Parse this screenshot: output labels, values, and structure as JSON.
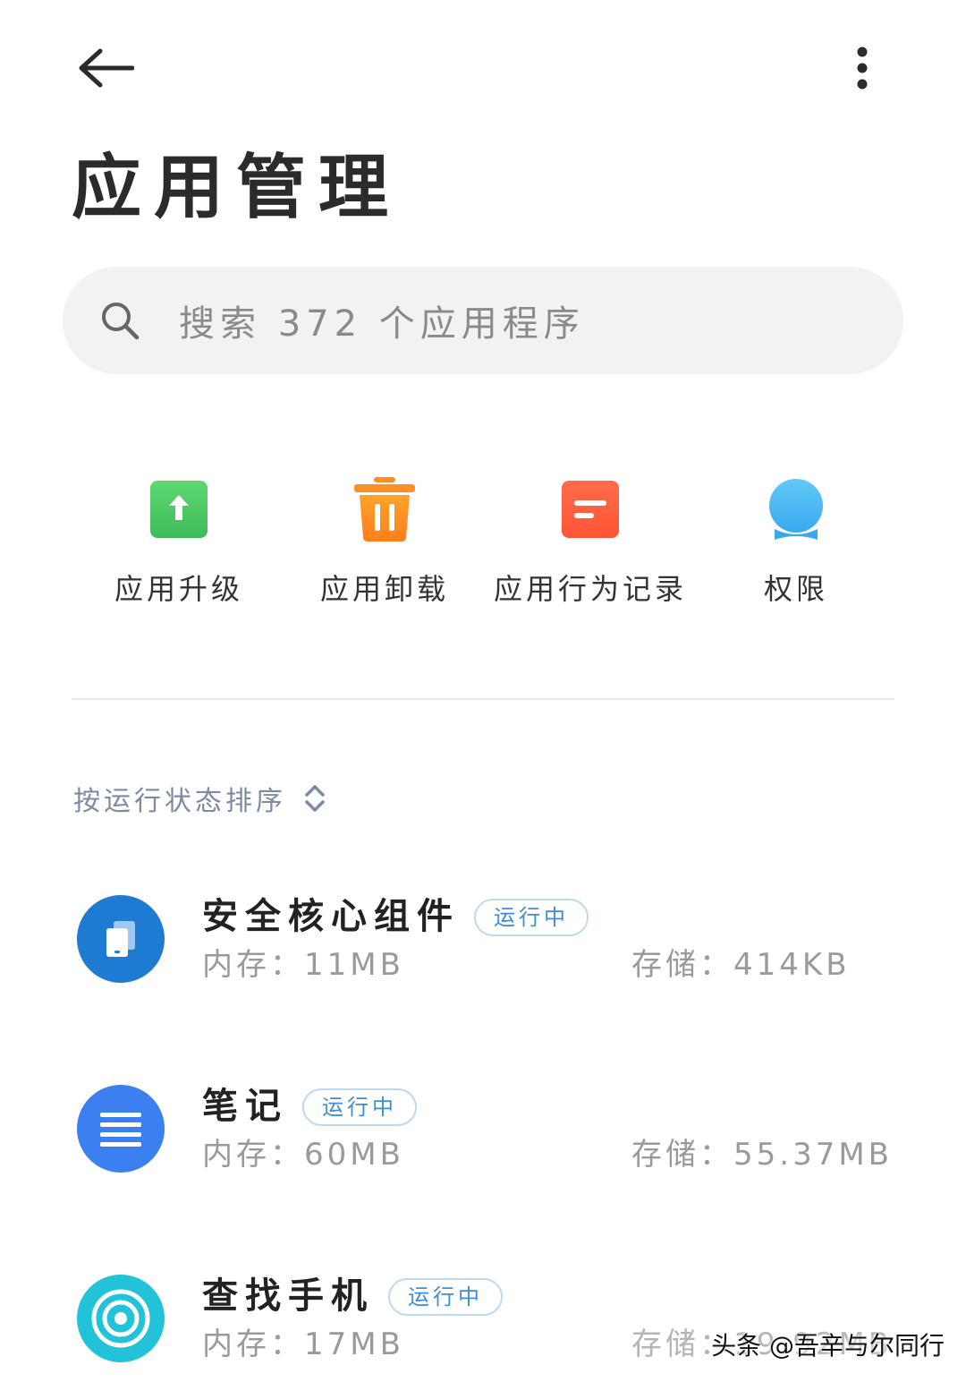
{
  "header": {
    "back_icon": "arrow-left-icon",
    "more_icon": "more-vertical-icon",
    "title": "应用管理"
  },
  "search": {
    "placeholder": "搜索 372 个应用程序",
    "icon": "search-icon"
  },
  "quick_actions": [
    {
      "label": "应用升级",
      "icon": "upgrade-icon",
      "color": "#4cc764"
    },
    {
      "label": "应用卸载",
      "icon": "trash-icon",
      "color": "#ff8a1f"
    },
    {
      "label": "应用行为记录",
      "icon": "behavior-record-icon",
      "color": "#ff6046"
    },
    {
      "label": "权限",
      "icon": "permission-icon",
      "color": "#3fb3f2"
    }
  ],
  "sort": {
    "label": "按运行状态排序",
    "icon": "sort-updown-icon"
  },
  "apps": [
    {
      "name": "安全核心组件",
      "badge": "运行中",
      "memory": "内存：11MB",
      "storage": "存储：414KB",
      "icon": "security-core-icon",
      "color": "#1f7ad1"
    },
    {
      "name": "笔记",
      "badge": "运行中",
      "memory": "内存：60MB",
      "storage": "存储：55.37MB",
      "icon": "notes-icon",
      "color": "#3b7ff0"
    },
    {
      "name": "查找手机",
      "badge": "运行中",
      "memory": "内存：17MB",
      "storage": "存储：19.92MB",
      "icon": "find-phone-icon",
      "color": "#22c3d8"
    }
  ],
  "watermark": "头条 @吾辛与尔同行"
}
